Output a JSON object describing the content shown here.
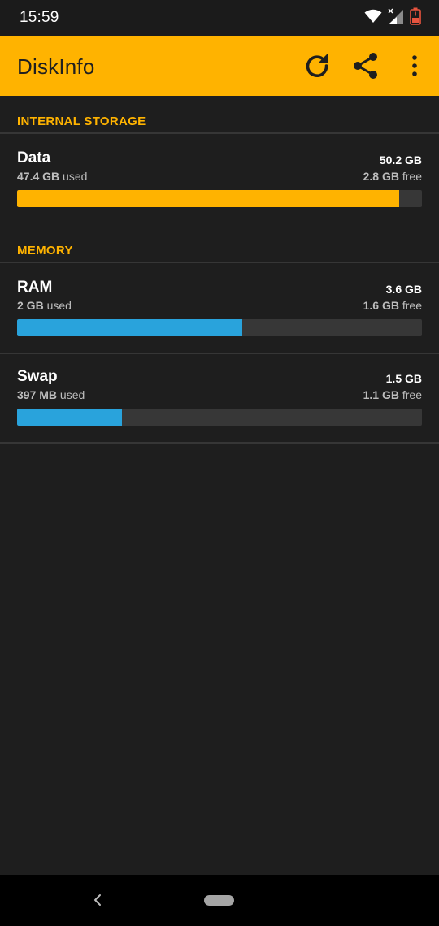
{
  "status_bar": {
    "time": "15:59",
    "icons": [
      "wifi-icon",
      "signal-icon",
      "battery-icon"
    ]
  },
  "app_bar": {
    "title": "DiskInfo",
    "actions": [
      "refresh-icon",
      "share-icon",
      "more-vert-icon"
    ],
    "background": "#ffb300"
  },
  "sections": {
    "internal": {
      "header": "INTERNAL STORAGE",
      "items": [
        {
          "name": "Data",
          "total": "50.2 GB",
          "used_amount": "47.4 GB",
          "used_suffix": " used",
          "free_amount": "2.8 GB",
          "free_suffix": " free",
          "fill_fraction": 0.944,
          "color": "#ffb300"
        }
      ]
    },
    "memory": {
      "header": "MEMORY",
      "items": [
        {
          "name": "RAM",
          "total": "3.6 GB",
          "used_amount": "2 GB",
          "used_suffix": " used",
          "free_amount": "1.6 GB",
          "free_suffix": " free",
          "fill_fraction": 0.556,
          "color": "#29a3dc"
        },
        {
          "name": "Swap",
          "total": "1.5 GB",
          "used_amount": "397 MB",
          "used_suffix": " used",
          "free_amount": "1.1 GB",
          "free_suffix": " free",
          "fill_fraction": 0.259,
          "color": "#29a3dc"
        }
      ]
    }
  },
  "nav_bar": {
    "icons": [
      "back-icon",
      "home-pill-icon"
    ]
  }
}
